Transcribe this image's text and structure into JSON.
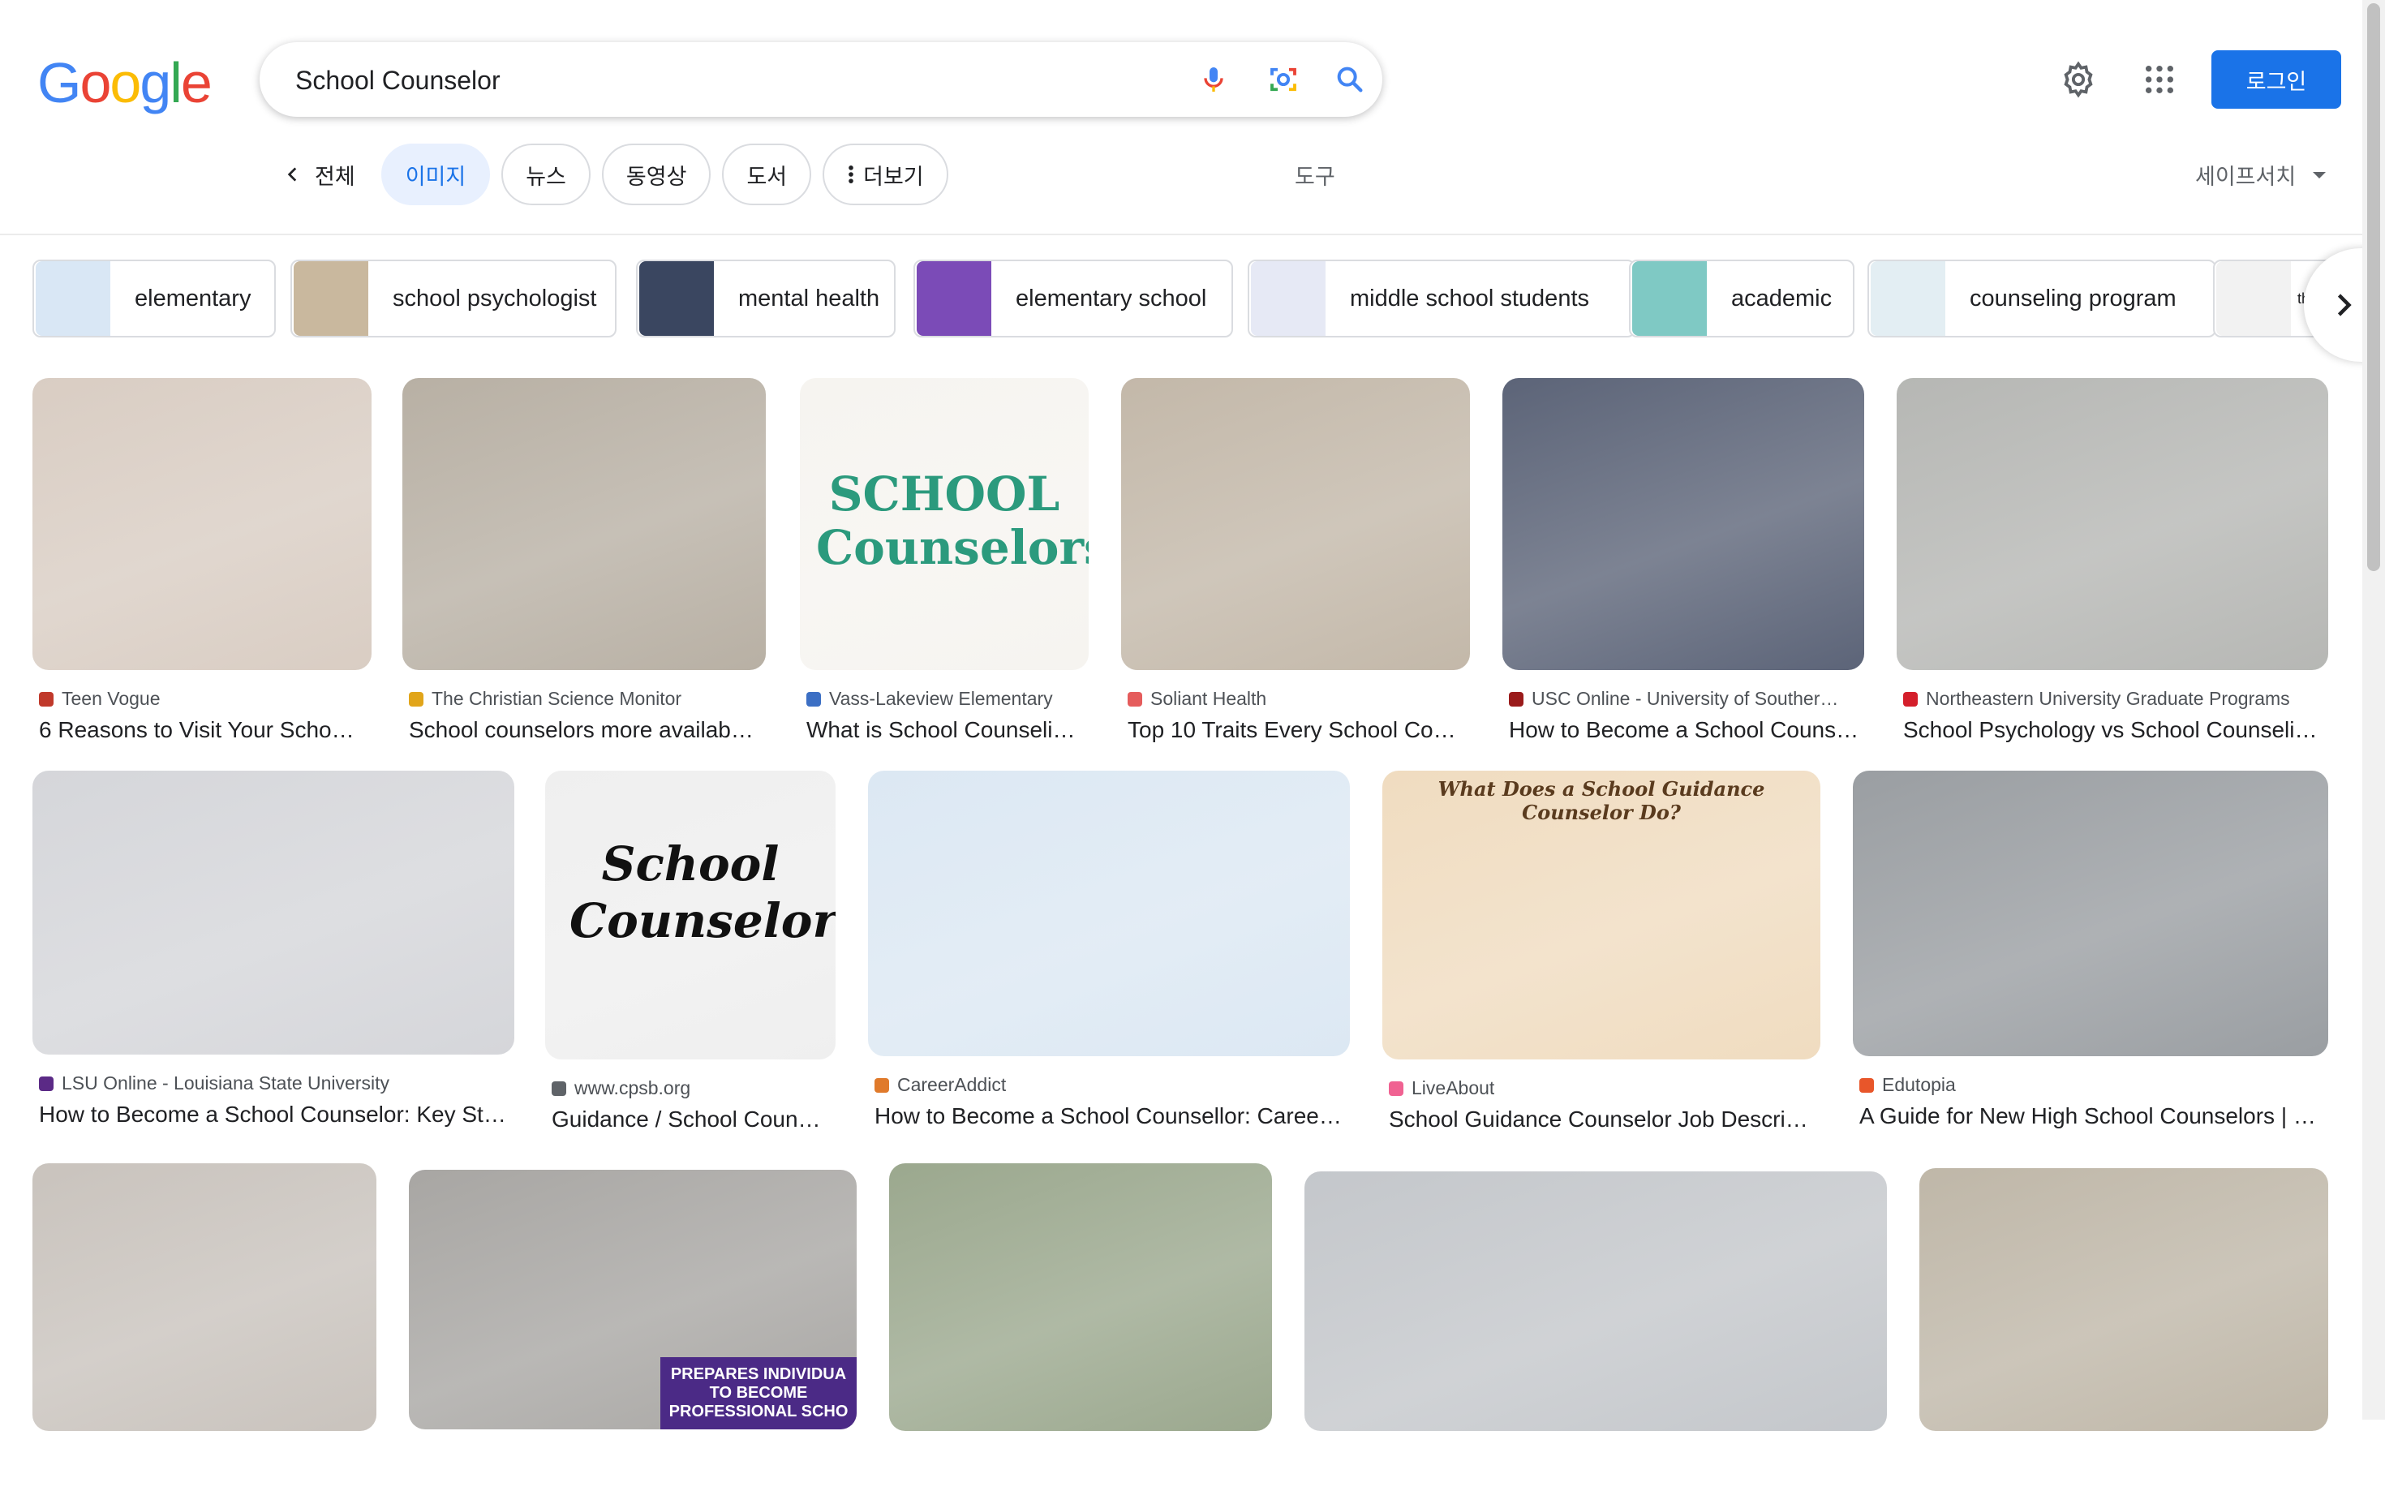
{
  "header": {
    "logo_text": "Google",
    "logo_colors": [
      "#4285F4",
      "#EA4335",
      "#FBBC05",
      "#4285F4",
      "#34A853",
      "#EA4335"
    ],
    "search_value": "School Counselor",
    "mic_icon": "mic-icon",
    "lens_icon": "camera-lens-icon",
    "search_icon": "search-icon",
    "settings_icon": "gear-icon",
    "apps_icon": "apps-grid-icon",
    "login_label": "로그인",
    "accent_color": "#1a73e8"
  },
  "tabs": {
    "items": [
      {
        "label": "전체",
        "state": "back"
      },
      {
        "label": "이미지",
        "state": "active"
      },
      {
        "label": "뉴스",
        "state": "normal"
      },
      {
        "label": "동영상",
        "state": "normal"
      },
      {
        "label": "도서",
        "state": "normal"
      },
      {
        "label": "더보기",
        "state": "more"
      }
    ],
    "tools_label": "도구",
    "safesearch_label": "세이프서치"
  },
  "chips": [
    {
      "label": "elementary",
      "thumb_color": "#d9e7f5"
    },
    {
      "label": "school psychologist",
      "thumb_color": "#c9b89e"
    },
    {
      "label": "mental health",
      "thumb_color": "#3a4660"
    },
    {
      "label": "elementary school",
      "thumb_color": "#7b4bb7"
    },
    {
      "label": "middle school students",
      "thumb_color": "#e6e9f5"
    },
    {
      "label": "academic",
      "thumb_color": "#7fc9c4"
    },
    {
      "label": "counseling program",
      "thumb_color": "#e3eef3"
    },
    {
      "label": "the School Co",
      "thumb_color": "#f2f2f2"
    }
  ],
  "results": [
    {
      "source": "Teen Vogue",
      "title": "6 Reasons to Visit Your Scho…",
      "bg": "#d9cdc3",
      "fav": "#c0392b"
    },
    {
      "source": "The Christian Science Monitor",
      "title": "School counselors more availab…",
      "bg": "#b8b0a4",
      "fav": "#e1a51a"
    },
    {
      "source": "Vass-Lakeview Elementary",
      "title": "What is School Counseli…",
      "bg": "#f6f4f0",
      "fav": "#3c6fc4",
      "art": "SCHOOL Counselors"
    },
    {
      "source": "Soliant Health",
      "title": "Top 10 Traits Every School Co…",
      "bg": "#c3b8a9",
      "fav": "#e55c5c"
    },
    {
      "source": "USC Online - University of Souther…",
      "title": "How to Become a School Couns…",
      "bg": "#5c6478",
      "fav": "#9a1b1b"
    },
    {
      "source": "Northeastern University Graduate Programs",
      "title": "School Psychology vs School Counseli…",
      "bg": "#b6b7b4",
      "fav": "#d41f2b"
    },
    {
      "source": "LSU Online - Louisiana State University",
      "title": "How to Become a School Counselor: Key St…",
      "bg": "#d5d6da",
      "fav": "#5b2a86"
    },
    {
      "source": "www.cpsb.org",
      "title": "Guidance / School Coun…",
      "bg": "#efefef",
      "fav": "#5f6368",
      "art": "School Counselor"
    },
    {
      "source": "CareerAddict",
      "title": "How to Become a School Counsellor: Caree…",
      "bg": "#dce8f3",
      "fav": "#e07a2b"
    },
    {
      "source": "LiveAbout",
      "title": "School Guidance Counselor Job Descri…",
      "bg": "#f0dcc0",
      "fav": "#f06292",
      "art": "What Does a School Guidance Counselor Do?"
    },
    {
      "source": "Edutopia",
      "title": "A Guide for New High School Counselors | …",
      "bg": "#9a9ea2",
      "fav": "#e8562a"
    },
    {
      "source": "",
      "title": "",
      "bg": "#c9c3bd",
      "fav": "#ffffff"
    },
    {
      "source": "",
      "title": "",
      "bg": "#a8a6a3",
      "fav": "#ffffff",
      "art": "PREPARES INDIVIDUA TO BECOME PROFESSIONAL SCHO"
    },
    {
      "source": "",
      "title": "",
      "bg": "#9ba88e",
      "fav": "#ffffff"
    },
    {
      "source": "",
      "title": "",
      "bg": "#c4c7cb",
      "fav": "#ffffff"
    },
    {
      "source": "",
      "title": "",
      "bg": "#bfb7a8",
      "fav": "#ffffff"
    }
  ]
}
